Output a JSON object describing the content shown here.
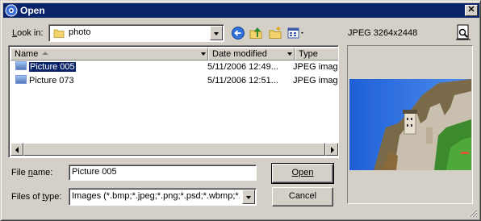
{
  "window": {
    "title": "Open"
  },
  "toolbar": {
    "look_in_label": "Look in:",
    "look_in_value": "photo",
    "icons": [
      "back-icon",
      "up-folder-icon",
      "new-folder-icon",
      "views-menu-icon"
    ]
  },
  "preview": {
    "info": "JPEG 3264x2448",
    "button_icon": "preview-toggle-icon"
  },
  "list": {
    "columns": [
      "Name",
      "Date modified",
      "Type"
    ],
    "rows": [
      {
        "name": "Picture 005",
        "date": "5/11/2006 12:49...",
        "type": "JPEG image",
        "selected": true
      },
      {
        "name": "Picture 073",
        "date": "5/11/2006 12:51...",
        "type": "JPEG image",
        "selected": false
      }
    ]
  },
  "form": {
    "file_name_label": "File name:",
    "file_name_value": "Picture 005",
    "file_type_label": "Files of type:",
    "file_type_value": "Images (*.bmp;*.jpeg;*.png;*.psd;*.wbmp;*.gif"
  },
  "buttons": {
    "open": "Open",
    "cancel": "Cancel"
  },
  "colors": {
    "titlebar": "#0a246a",
    "selection": "#0a246a",
    "face": "#d4d0c8"
  }
}
